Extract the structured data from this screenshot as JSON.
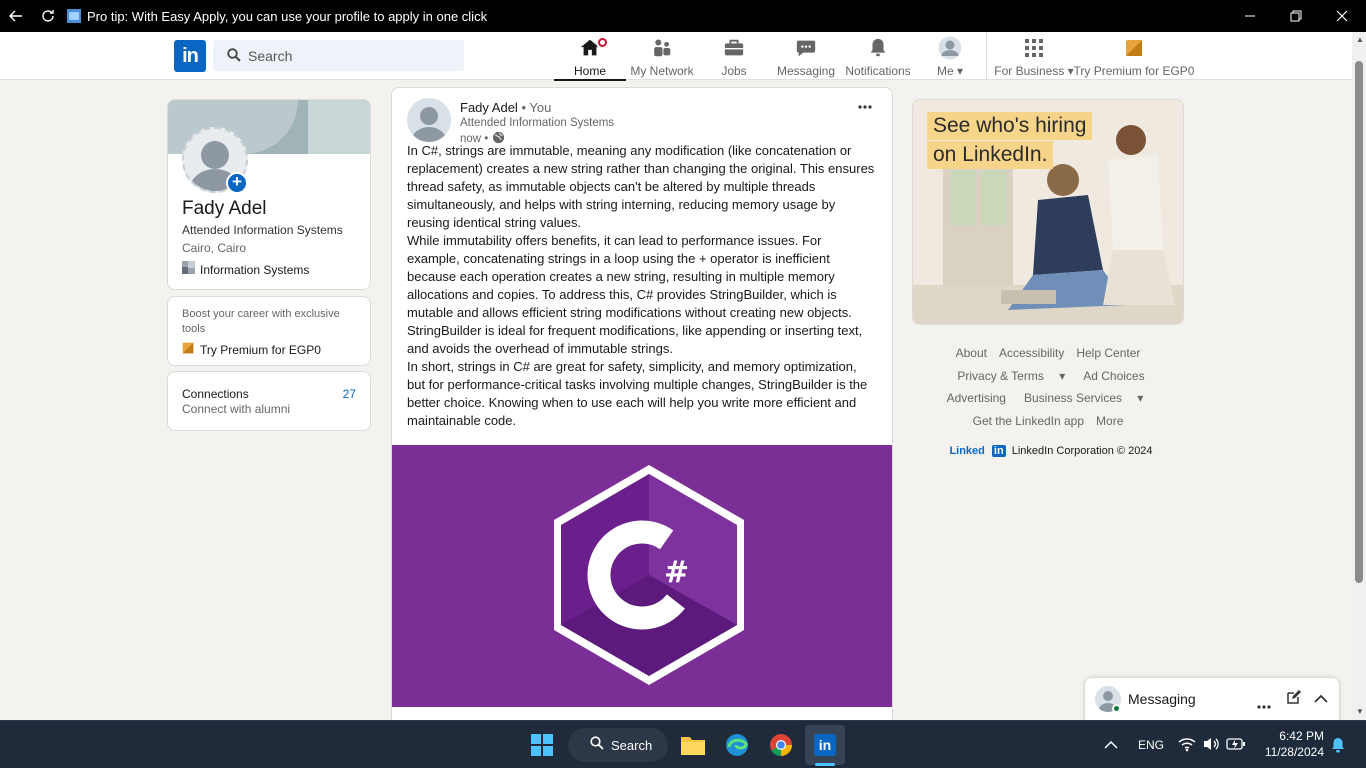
{
  "browser": {
    "title": "Pro tip: With Easy Apply, you can use your profile to apply in one click"
  },
  "nav": {
    "logo_text": "in",
    "search_placeholder": "Search",
    "items": [
      {
        "label": "Home",
        "icon": "home-icon"
      },
      {
        "label": "My Network",
        "icon": "network-icon"
      },
      {
        "label": "Jobs",
        "icon": "briefcase-icon"
      },
      {
        "label": "Messaging",
        "icon": "chat-icon"
      },
      {
        "label": "Notifications",
        "icon": "bell-icon"
      },
      {
        "label": "Me",
        "icon": "avatar-icon"
      },
      {
        "label": "For Business",
        "icon": "grid-icon"
      },
      {
        "label": "Try Premium for EGP0",
        "icon": "premium-icon"
      }
    ]
  },
  "profile": {
    "name": "Fady Adel",
    "headline": "Attended Information Systems",
    "location": "Cairo, Cairo",
    "org": "Information Systems",
    "premium_promo": "Boost your career with exclusive tools",
    "premium_link": "Try Premium for EGP0",
    "connections_label": "Connections",
    "connections_sub": "Connect with alumni",
    "connections_count": "27"
  },
  "post": {
    "author": "Fady Adel",
    "you": "• You",
    "headline": "Attended Information Systems",
    "time": "now •",
    "para1": "In C#, strings are immutable, meaning any modification (like concatenation or replacement) creates a new string rather than changing the original. This ensures thread safety, as immutable objects can't be altered by multiple threads simultaneously, and helps with string interning, reducing memory usage by reusing identical string values.",
    "para2": "While immutability offers benefits, it can lead to performance issues. For example, concatenating strings in a loop using the + operator is inefficient because each operation creates a new string, resulting in multiple memory allocations and copies. To address this, C# provides StringBuilder, which is mutable and allows efficient string modifications without creating new objects. StringBuilder is ideal for frequent modifications, like appending or inserting text, and avoids the overhead of immutable strings.",
    "para3": "In short, strings in C# are great for safety, simplicity, and memory optimization, but for performance-critical tasks involving multiple changes, StringBuilder is the better choice. Knowing when to use each will help you write more efficient and maintainable code.",
    "image_text": "C#"
  },
  "ad": {
    "line1": "See who's hiring",
    "line2": "on LinkedIn."
  },
  "footer": {
    "about": "About",
    "accessibility": "Accessibility",
    "help": "Help Center",
    "privacy": "Privacy & Terms",
    "adchoices": "Ad Choices",
    "advertising": "Advertising",
    "business": "Business Services",
    "app": "Get the LinkedIn app",
    "more": "More",
    "brand_text": "Linked",
    "brand_in": "in",
    "copyright": "LinkedIn Corporation © 2024"
  },
  "messaging": {
    "label": "Messaging"
  },
  "taskbar": {
    "search_label": "Search",
    "lang": "ENG",
    "time": "6:42 PM",
    "date": "11/28/2024"
  },
  "colors": {
    "linkedin_blue": "#0a66c2",
    "csharp_purple": "#7b2f96",
    "badge_red": "#cb112d",
    "premium_gold": "#e7a33e"
  }
}
